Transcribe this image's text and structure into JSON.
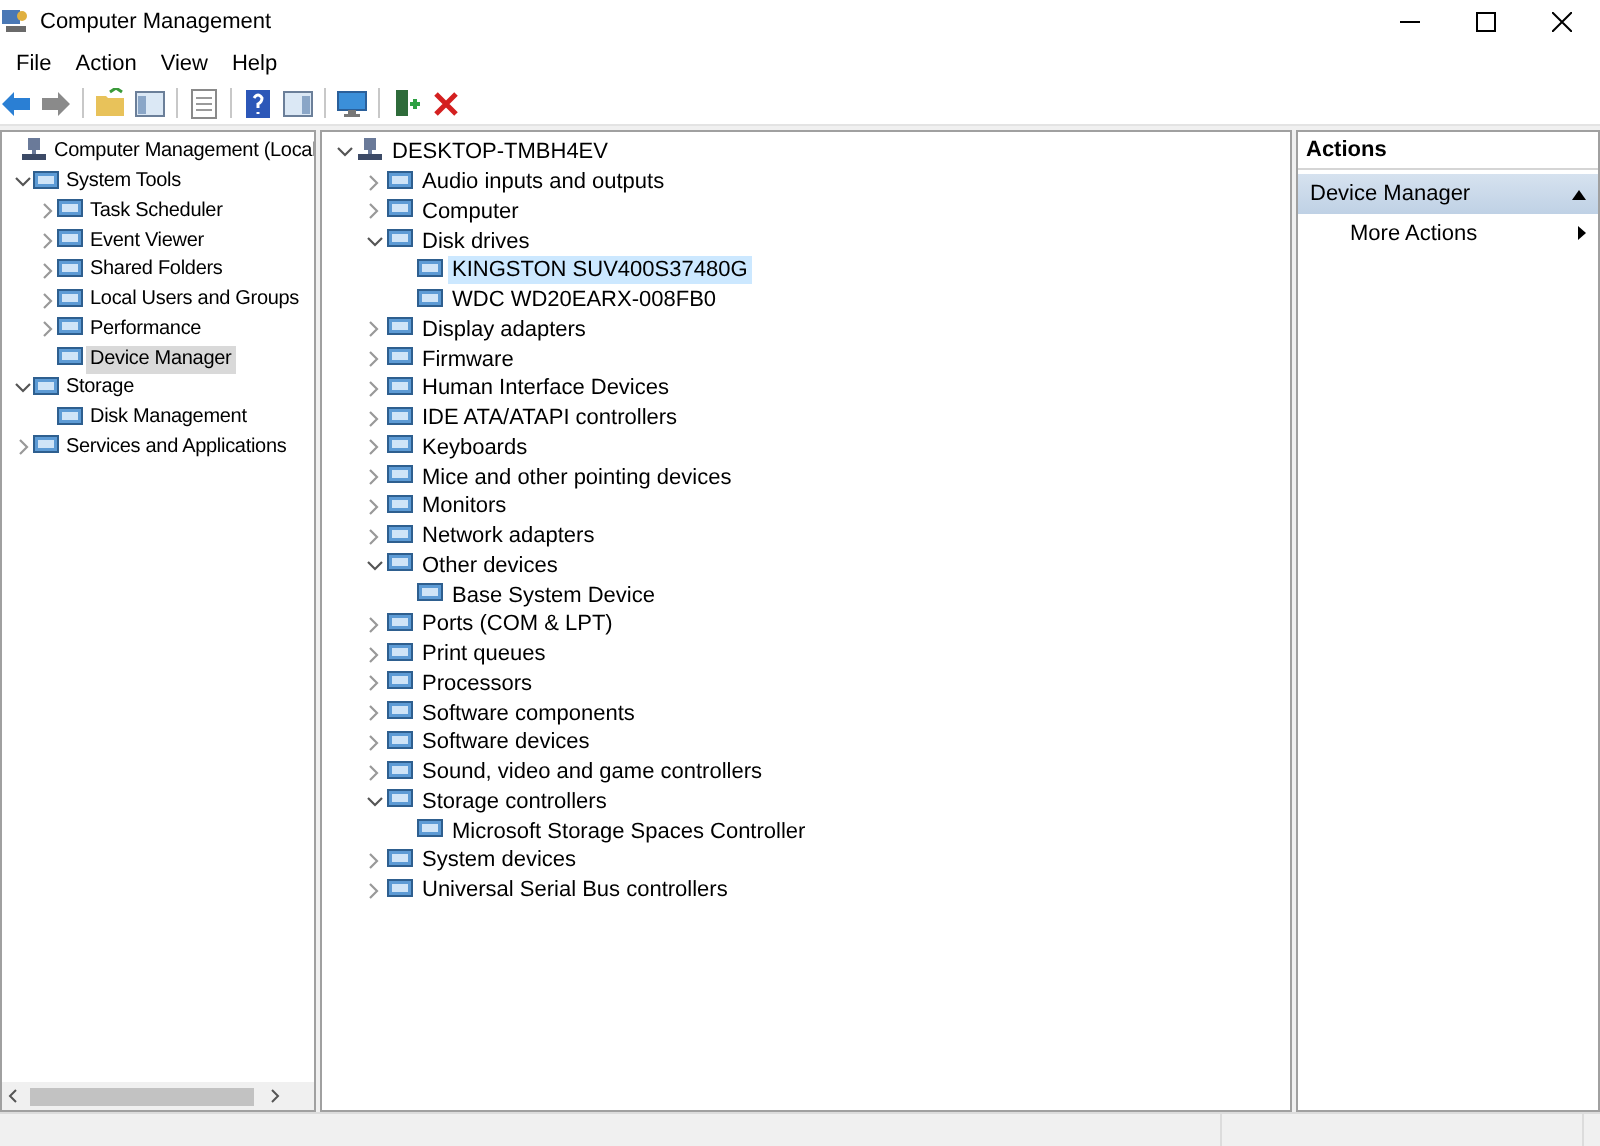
{
  "window": {
    "title": "Computer Management"
  },
  "menu": [
    "File",
    "Action",
    "View",
    "Help"
  ],
  "console_tree": [
    {
      "label": "Computer Management (Local",
      "selected": false,
      "children": [
        {
          "label": "System Tools",
          "expanded": true,
          "selected": false,
          "children": [
            {
              "label": "Task Scheduler",
              "expanded": false,
              "selected": false
            },
            {
              "label": "Event Viewer",
              "expanded": false,
              "selected": false
            },
            {
              "label": "Shared Folders",
              "expanded": false,
              "selected": false
            },
            {
              "label": "Local Users and Groups",
              "expanded": false,
              "selected": false
            },
            {
              "label": "Performance",
              "expanded": false,
              "selected": false
            },
            {
              "label": "Device Manager",
              "selected": true
            }
          ]
        },
        {
          "label": "Storage",
          "expanded": true,
          "selected": false,
          "children": [
            {
              "label": "Disk Management",
              "selected": false
            }
          ]
        },
        {
          "label": "Services and Applications",
          "expanded": false,
          "selected": false
        }
      ]
    }
  ],
  "device_tree": [
    {
      "label": "DESKTOP-TMBH4EV",
      "expanded": true,
      "selected": false,
      "children": [
        {
          "label": "Audio inputs and outputs",
          "expanded": false,
          "selected": false
        },
        {
          "label": "Computer",
          "expanded": false,
          "selected": false
        },
        {
          "label": "Disk drives",
          "expanded": true,
          "selected": false,
          "children": [
            {
              "label": "KINGSTON SUV400S37480G",
              "selected": true
            },
            {
              "label": "WDC WD20EARX-008FB0",
              "selected": false
            }
          ]
        },
        {
          "label": "Display adapters",
          "expanded": false,
          "selected": false
        },
        {
          "label": "Firmware",
          "expanded": false,
          "selected": false
        },
        {
          "label": "Human Interface Devices",
          "expanded": false,
          "selected": false
        },
        {
          "label": "IDE ATA/ATAPI controllers",
          "expanded": false,
          "selected": false
        },
        {
          "label": "Keyboards",
          "expanded": false,
          "selected": false
        },
        {
          "label": "Mice and other pointing devices",
          "expanded": false,
          "selected": false
        },
        {
          "label": "Monitors",
          "expanded": false,
          "selected": false
        },
        {
          "label": "Network adapters",
          "expanded": false,
          "selected": false
        },
        {
          "label": "Other devices",
          "expanded": true,
          "selected": false,
          "children": [
            {
              "label": "Base System Device",
              "selected": false
            }
          ]
        },
        {
          "label": "Ports (COM & LPT)",
          "expanded": false,
          "selected": false
        },
        {
          "label": "Print queues",
          "expanded": false,
          "selected": false
        },
        {
          "label": "Processors",
          "expanded": false,
          "selected": false
        },
        {
          "label": "Software components",
          "expanded": false,
          "selected": false
        },
        {
          "label": "Software devices",
          "expanded": false,
          "selected": false
        },
        {
          "label": "Sound, video and game controllers",
          "expanded": false,
          "selected": false
        },
        {
          "label": "Storage controllers",
          "expanded": true,
          "selected": false,
          "children": [
            {
              "label": "Microsoft Storage Spaces Controller",
              "selected": false
            }
          ]
        },
        {
          "label": "System devices",
          "expanded": false,
          "selected": false
        },
        {
          "label": "Universal Serial Bus controllers",
          "expanded": false,
          "selected": false
        }
      ]
    }
  ],
  "actions": {
    "title": "Actions",
    "sections": [
      {
        "label": "Device Manager",
        "expanded": true,
        "items": [
          "More Actions"
        ]
      }
    ]
  }
}
